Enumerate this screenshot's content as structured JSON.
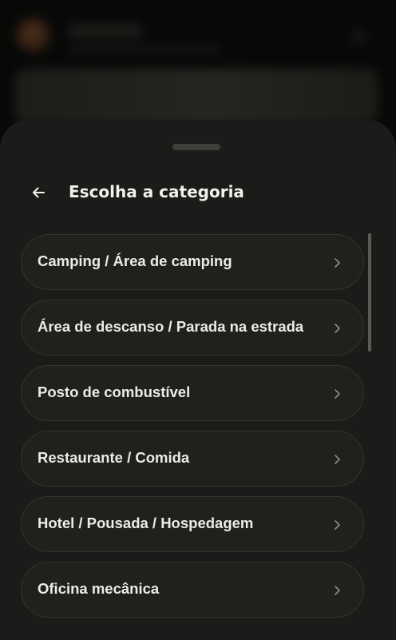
{
  "sheet": {
    "title": "Escolha a categoria",
    "back_icon": "arrow-left-icon",
    "categories": [
      {
        "label": "Camping / Área de camping",
        "icon": "chevron-right-icon"
      },
      {
        "label": "Área de descanso / Parada na estrada",
        "icon": "chevron-right-icon"
      },
      {
        "label": "Posto de combustível",
        "icon": "chevron-right-icon"
      },
      {
        "label": "Restaurante / Comida",
        "icon": "chevron-right-icon"
      },
      {
        "label": "Hotel / Pousada / Hospedagem",
        "icon": "chevron-right-icon"
      },
      {
        "label": "Oficina mecânica",
        "icon": "chevron-right-icon"
      }
    ]
  },
  "colors": {
    "sheet_background": "#1b1c19",
    "item_background": "#20211d",
    "text": "#ecece6"
  }
}
